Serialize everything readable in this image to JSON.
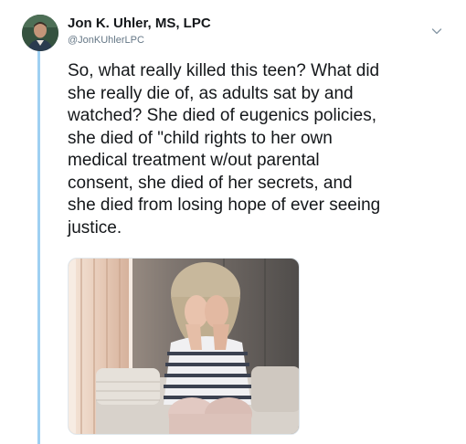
{
  "author": {
    "name": "Jon K. Uhler, MS, LPC",
    "handle": "@JonKUhlerLPC",
    "avatar_icon": "profile-photo"
  },
  "tweet": {
    "text": "So, what really killed this teen? What did\nshe really die of, as adults sat by and\nwatched? She died of eugenics policies,\nshe died of \"child rights to her own\nmedical treatment w/out parental\nconsent, she died of her secrets, and\nshe died from losing hope of ever seeing\njustice."
  },
  "menu": {
    "icon": "chevron-down-icon"
  },
  "media": {
    "icon": "photo-crying-woman-on-couch"
  },
  "colors": {
    "thread_line": "#9fd0f2",
    "text": "#14171a",
    "secondary": "#657786"
  }
}
